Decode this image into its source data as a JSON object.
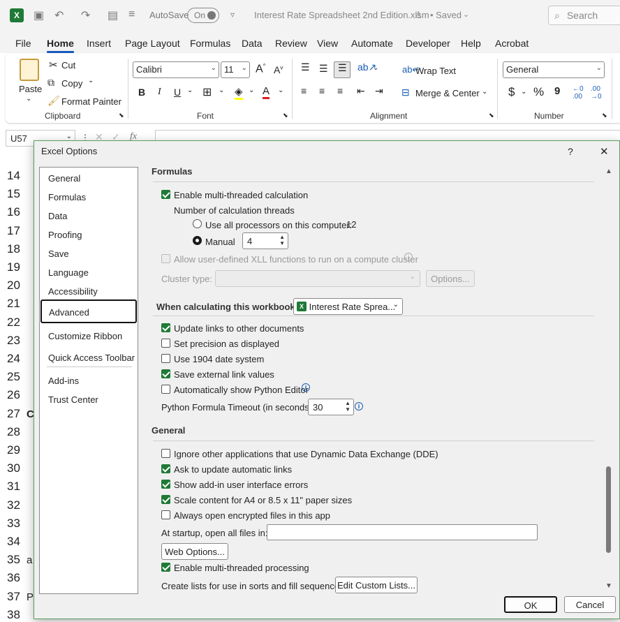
{
  "titlebar": {
    "autosave_label": "AutoSave",
    "autosave_state": "On",
    "filename": "Interest Rate Spreadsheet 2nd Edition.xlsm",
    "saved_status": "• Saved",
    "search_placeholder": "Search"
  },
  "menu": {
    "tabs": [
      "File",
      "Home",
      "Insert",
      "Page Layout",
      "Formulas",
      "Data",
      "Review",
      "View",
      "Automate",
      "Developer",
      "Help",
      "Acrobat"
    ],
    "active": "Home"
  },
  "ribbon": {
    "paste": "Paste",
    "cut": "Cut",
    "copy": "Copy",
    "format_painter": "Format Painter",
    "clipboard": "Clipboard",
    "font_name": "Calibri",
    "font_size": "11",
    "bold": "B",
    "italic": "I",
    "underline": "U",
    "font_group": "Font",
    "wrap_text": "Wrap Text",
    "merge_center": "Merge & Center",
    "alignment": "Alignment",
    "number_format": "General",
    "number": "Number",
    "currency": "$",
    "percent": "%",
    "comma": "9"
  },
  "formula_bar": {
    "name_box": "U57",
    "fx": "fx"
  },
  "rows": [
    {
      "n": "14",
      "c": ""
    },
    {
      "n": "15",
      "c": ""
    },
    {
      "n": "16",
      "c": ""
    },
    {
      "n": "17",
      "c": ""
    },
    {
      "n": "18",
      "c": ""
    },
    {
      "n": "19",
      "c": ""
    },
    {
      "n": "20",
      "c": ""
    },
    {
      "n": "21",
      "c": ""
    },
    {
      "n": "22",
      "c": ""
    },
    {
      "n": "23",
      "c": ""
    },
    {
      "n": "24",
      "c": ""
    },
    {
      "n": "25",
      "c": ""
    },
    {
      "n": "26",
      "c": ""
    },
    {
      "n": "27",
      "c": "C"
    },
    {
      "n": "28",
      "c": ""
    },
    {
      "n": "29",
      "c": ""
    },
    {
      "n": "30",
      "c": ""
    },
    {
      "n": "31",
      "c": ""
    },
    {
      "n": "32",
      "c": ""
    },
    {
      "n": "33",
      "c": ""
    },
    {
      "n": "34",
      "c": ""
    },
    {
      "n": "35",
      "c": "a"
    },
    {
      "n": "36",
      "c": ""
    },
    {
      "n": "37",
      "c": "P"
    },
    {
      "n": "38",
      "c": ""
    }
  ],
  "dialog": {
    "title": "Excel Options",
    "help": "?",
    "close": "✕",
    "nav": [
      "General",
      "Formulas",
      "Data",
      "Proofing",
      "Save",
      "Language",
      "Accessibility",
      "Advanced",
      "Customize Ribbon",
      "Quick Access Toolbar",
      "Add-ins",
      "Trust Center"
    ],
    "nav_selected": "Advanced",
    "formulas_heading": "Formulas",
    "multithreaded": "Enable multi-threaded calculation",
    "threads_label": "Number of calculation threads",
    "use_all": "Use all processors on this computer:",
    "processor_count": "12",
    "manual": "Manual",
    "manual_value": "4",
    "allow_xll": "Allow user-defined XLL functions to run on a compute cluster",
    "cluster_type": "Cluster type:",
    "options_btn": "Options...",
    "when_calc": "When calculating this workbook:",
    "workbook_select": "Interest Rate Sprea...",
    "update_links": "Update links to other documents",
    "set_precision": "Set precision as displayed",
    "use_1904": "Use 1904 date system",
    "save_external": "Save external link values",
    "auto_python": "Automatically show Python Editor",
    "python_timeout": "Python Formula Timeout (in seconds)",
    "python_timeout_value": "30",
    "general_heading": "General",
    "ignore_dde": "Ignore other applications that use Dynamic Data Exchange (DDE)",
    "ask_update": "Ask to update automatic links",
    "show_addin_errors": "Show add-in user interface errors",
    "scale_content": "Scale content for A4 or 8.5 x 11\" paper sizes",
    "always_open_encrypted": "Always open encrypted files in this app",
    "startup_open": "At startup, open all files in:",
    "web_options": "Web Options...",
    "enable_mt_processing": "Enable multi-threaded processing",
    "create_lists": "Create lists for use in sorts and fill sequences:",
    "edit_custom_lists": "Edit Custom Lists...",
    "ok": "OK",
    "cancel": "Cancel"
  },
  "accent_colors": {
    "excel_green": "#1e7a36",
    "home_underline": "#185abd"
  }
}
